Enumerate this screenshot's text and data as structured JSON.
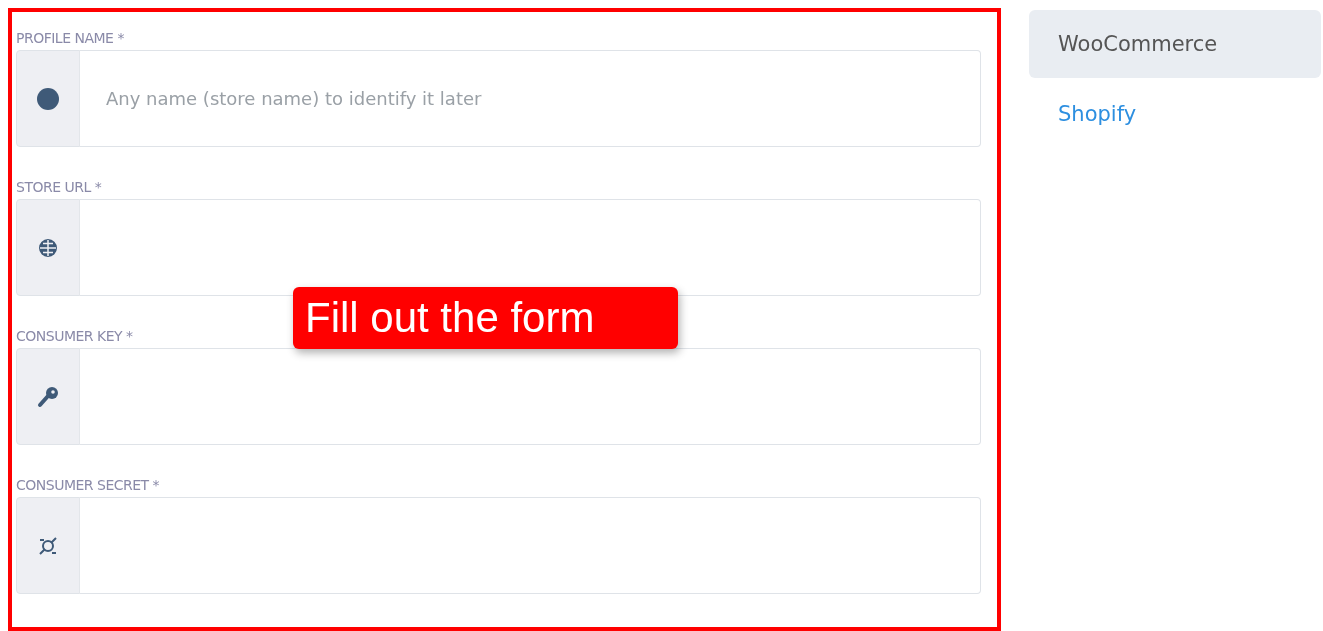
{
  "form": {
    "fields": [
      {
        "label": "PROFILE NAME *",
        "placeholder": "Any name (store name) to identify it later"
      },
      {
        "label": "STORE URL *"
      },
      {
        "label": "CONSUMER KEY *"
      },
      {
        "label": "CONSUMER SECRET *"
      }
    ]
  },
  "callout": {
    "text": "Fill out the form"
  },
  "platforms": [
    {
      "label": "WooCommerce",
      "selected": true
    },
    {
      "label": "Shopify",
      "selected": false
    }
  ]
}
